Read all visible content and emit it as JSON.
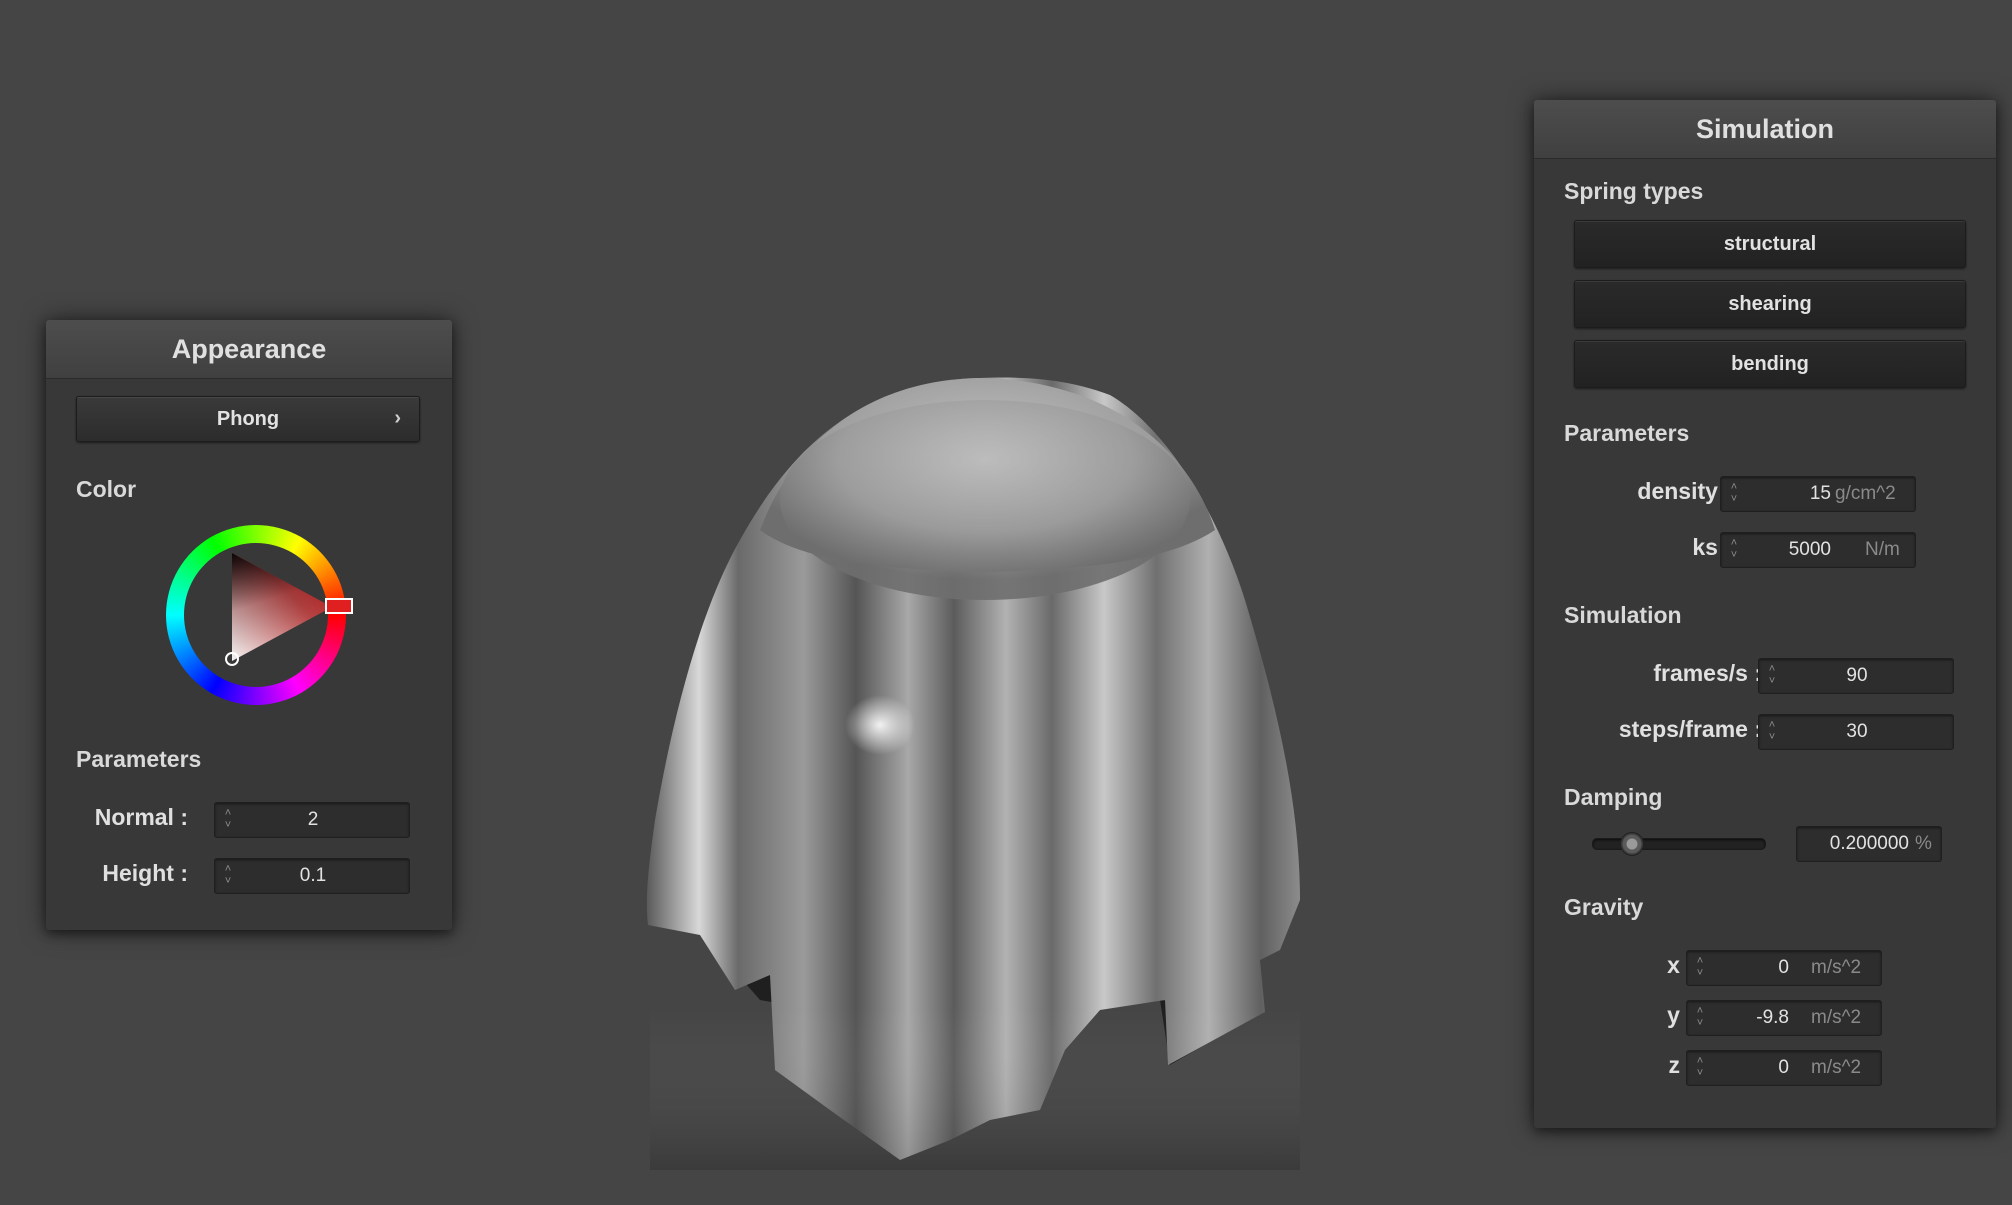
{
  "appearance": {
    "title": "Appearance",
    "shader_button": "Phong",
    "color_label": "Color",
    "params_label": "Parameters",
    "normal_label": "Normal :",
    "normal_value": "2",
    "height_label": "Height :",
    "height_value": "0.1",
    "selected_hue": "#e02020"
  },
  "simulation": {
    "title": "Simulation",
    "spring_types_label": "Spring types",
    "spring_buttons": [
      "structural",
      "shearing",
      "bending"
    ],
    "params_label": "Parameters",
    "density_label": "density :",
    "density_value": "15",
    "density_unit": "g/cm^2",
    "ks_label": "ks :",
    "ks_value": "5000",
    "ks_unit": "N/m",
    "sim_label": "Simulation",
    "fps_label": "frames/s :",
    "fps_value": "90",
    "steps_label": "steps/frame :",
    "steps_value": "30",
    "damping_label": "Damping",
    "damping_value": "0.200000",
    "damping_unit": "%",
    "damping_fraction": 0.2,
    "gravity_label": "Gravity",
    "gx_label": "x :",
    "gx_value": "0",
    "gy_label": "y :",
    "gy_value": "-9.8",
    "gz_label": "z :",
    "gz_value": "0",
    "gravity_unit": "m/s^2"
  },
  "colors": {
    "background": "#454545",
    "panel": "#383838",
    "cloth": "#9a9a9a"
  },
  "icons": {
    "chevron": "chevron-right-icon",
    "spin": "spin-arrows-icon"
  }
}
